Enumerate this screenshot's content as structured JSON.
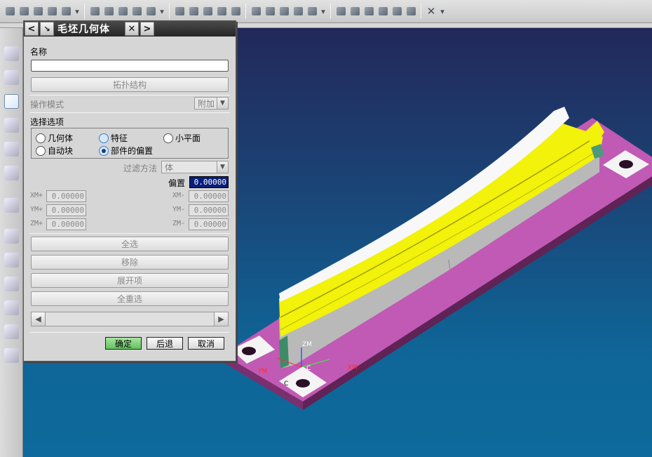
{
  "toolbar": {
    "icons": [
      "cursor-icon",
      "operation-icon",
      "geometry-icon",
      "tool-icon",
      "method-icon",
      "dropdown-icon",
      "generate-path-icon",
      "verify-icon",
      "replay-icon",
      "list-icon",
      "postprocess-icon",
      "dropdown-icon",
      "create-program-icon",
      "create-tool-icon",
      "create-geometry-icon",
      "create-method-icon",
      "create-operation-icon",
      "feature-icon",
      "shop-doc-icon",
      "output-icon",
      "program-view-icon",
      "simulate-icon",
      "dropdown-icon",
      "cam-setup-icon",
      "part-icon",
      "analysis-icon",
      "layer-icon",
      "view-icon",
      "render-icon",
      "close-x-icon",
      "dropdown-icon"
    ]
  },
  "dialog": {
    "title": "毛坯几何体",
    "back_glyph": "<",
    "forward_glyph": ">",
    "close_glyph": "✕",
    "name_label": "名称",
    "name_value": "",
    "topology_button": "拓扑结构",
    "operation_mode_label": "操作模式",
    "operation_mode_value": "附加",
    "selection_options_label": "选择选项",
    "options": [
      {
        "label": "几何体",
        "selected": false
      },
      {
        "label": "特征",
        "selected": false
      },
      {
        "label": "小平面",
        "selected": false
      },
      {
        "label": "自动块",
        "selected": false
      },
      {
        "label": "部件的偏置",
        "selected": true
      }
    ],
    "filter_label": "过滤方法",
    "filter_value": "体",
    "offset_label": "偏置",
    "offset_value": "0.00000",
    "xm_plus_label": "XM+",
    "xm_plus_value": "0.00000",
    "xm_minus_label": "XM-",
    "xm_minus_value": "0.00000",
    "ym_plus_label": "YM+",
    "ym_plus_value": "0.00000",
    "ym_minus_label": "YM-",
    "ym_minus_value": "0.00000",
    "zm_plus_label": "ZM+",
    "zm_plus_value": "0.00000",
    "zm_minus_label": "ZM-",
    "zm_minus_value": "0.00000",
    "select_all_button": "全选",
    "remove_button": "移除",
    "expand_button": "展开项",
    "reselect_all_button": "全重选",
    "ok_button": "确定",
    "back_button": "后退",
    "cancel_button": "取消"
  },
  "viewport": {
    "axis_zm": "ZM",
    "axis_ym": "YM",
    "axis_xm": "XM",
    "label_c1": "C",
    "label_c2": "C"
  },
  "colors": {
    "part_yellow": "#f2f20a",
    "base_magenta": "#c05ab4",
    "ok_green": "#62c35c",
    "offset_field": "#0a1e7a"
  }
}
